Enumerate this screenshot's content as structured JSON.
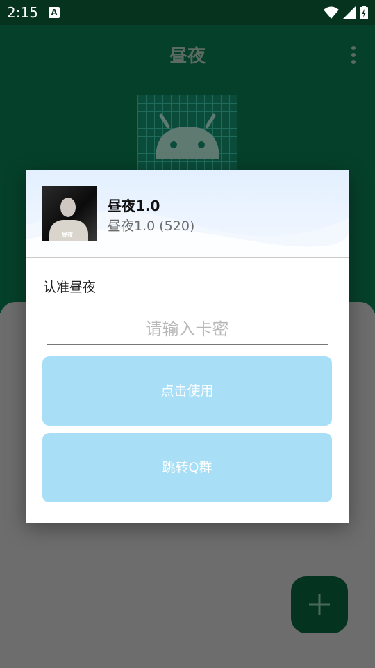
{
  "status_bar": {
    "time": "2:15",
    "notification_badge": "A",
    "icons": [
      "wifi-icon",
      "cellular-signal-icon",
      "battery-charging-icon"
    ]
  },
  "app_bar": {
    "title": "昼夜",
    "overflow_icon": "more-vert-icon"
  },
  "fab": {
    "icon": "plus-icon"
  },
  "dialog": {
    "app_name": "昼夜1.0",
    "app_version": "昼夜1.0 (520)",
    "avatar_watermark": "昼夜",
    "notice": "认准昼夜",
    "card_input": {
      "value": "",
      "placeholder": "请输入卡密"
    },
    "use_button_label": "点击使用",
    "qq_group_button_label": "跳转Q群"
  },
  "colors": {
    "status_bar": "#05331e",
    "app_bar": "#05402a",
    "scrim": "#6b6b6b",
    "button": "#a8dff7",
    "dialog_header": "#e4f0ff"
  }
}
